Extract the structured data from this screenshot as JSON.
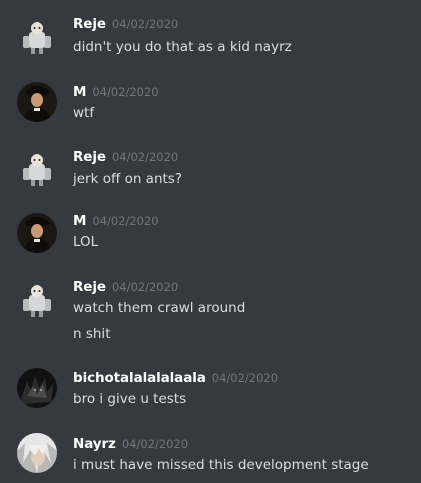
{
  "messages": [
    {
      "author": "Reje",
      "timestamp": "04/02/2020",
      "avatar_icon": "robot-figure-avatar",
      "lines": [
        "didn't you do that as a kid nayrz"
      ]
    },
    {
      "author": "M",
      "timestamp": "04/02/2020",
      "avatar_icon": "priest-portrait-avatar",
      "lines": [
        "wtf"
      ]
    },
    {
      "author": "Reje",
      "timestamp": "04/02/2020",
      "avatar_icon": "robot-figure-avatar",
      "lines": [
        "jerk off on ants?"
      ]
    },
    {
      "author": "M",
      "timestamp": "04/02/2020",
      "avatar_icon": "priest-portrait-avatar",
      "lines": [
        "LOL"
      ]
    },
    {
      "author": "Reje",
      "timestamp": "04/02/2020",
      "avatar_icon": "robot-figure-avatar",
      "lines": [
        "watch them crawl around",
        "n shit"
      ]
    },
    {
      "author": "bichotalalalalaala",
      "timestamp": "04/02/2020",
      "avatar_icon": "dark-creature-avatar",
      "lines": [
        "bro i give u tests"
      ]
    },
    {
      "author": "Nayrz",
      "timestamp": "04/02/2020",
      "avatar_icon": "white-haired-character-avatar",
      "lines": [
        "i must have missed this development stage"
      ]
    }
  ],
  "colors": {
    "background": "#36393f",
    "username": "#ffffff",
    "timestamp": "#72767d",
    "message_text": "#dcddde"
  }
}
